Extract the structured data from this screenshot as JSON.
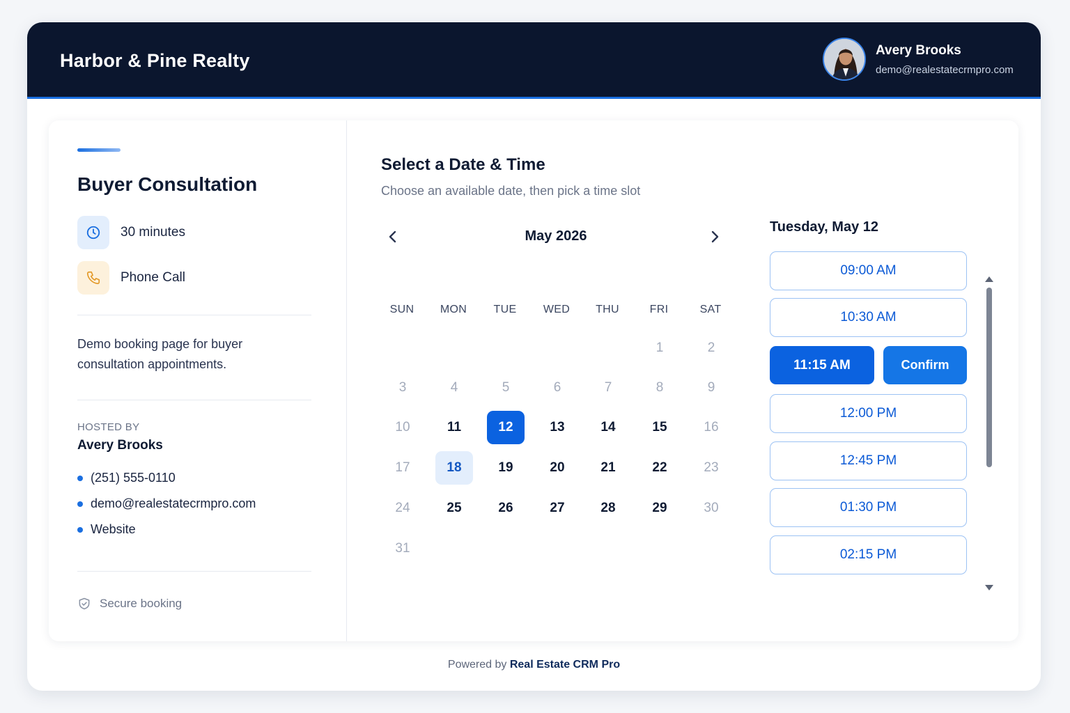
{
  "header": {
    "brand": "Harbor & Pine Realty",
    "user_name": "Avery Brooks",
    "user_email": "demo@realestatecrmpro.com"
  },
  "event": {
    "title": "Buyer Consultation",
    "duration": "30 minutes",
    "duration_icon": "clock-icon",
    "location": "Phone Call",
    "location_icon": "phone-icon",
    "description": "Demo booking page for buyer consultation appointments.",
    "hosted_by_label": "HOSTED BY",
    "host_name": "Avery Brooks",
    "contacts": [
      "(251) 555-0110",
      "demo@realestatecrmpro.com",
      "Website"
    ],
    "secure_label": "Secure booking"
  },
  "scheduler": {
    "title": "Select a Date & Time",
    "subtitle": "Choose an available date, then pick a time slot",
    "month_label": "May 2026",
    "weekdays": [
      "SUN",
      "MON",
      "TUE",
      "WED",
      "THU",
      "FRI",
      "SAT"
    ],
    "weeks": [
      [
        null,
        null,
        null,
        null,
        null,
        "1",
        "2"
      ],
      [
        "3",
        "4",
        "5",
        "6",
        "7",
        "8",
        "9"
      ],
      [
        "10",
        "11",
        "12",
        "13",
        "14",
        "15",
        "16"
      ],
      [
        "17",
        "18",
        "19",
        "20",
        "21",
        "22",
        "23"
      ],
      [
        "24",
        "25",
        "26",
        "27",
        "28",
        "29",
        "30"
      ],
      [
        "31",
        null,
        null,
        null,
        null,
        null,
        null
      ]
    ],
    "available_days": [
      "11",
      "12",
      "13",
      "14",
      "15",
      "18",
      "19",
      "20",
      "21",
      "22",
      "25",
      "26",
      "27",
      "28",
      "29"
    ],
    "selected_day": "12",
    "highlighted_day": "18"
  },
  "slots": {
    "date_label": "Tuesday, May 12",
    "times": [
      "09:00 AM",
      "10:30 AM",
      "11:15 AM",
      "12:00 PM",
      "12:45 PM",
      "01:30 PM",
      "02:15 PM"
    ],
    "selected_time": "11:15 AM",
    "confirm_label": "Confirm"
  },
  "footer": {
    "prefix": "Powered by",
    "brand": "Real Estate CRM Pro"
  },
  "colors": {
    "accent": "#0b62e0",
    "header_bg": "#0b162e",
    "slot_border": "#9cc2f4"
  }
}
